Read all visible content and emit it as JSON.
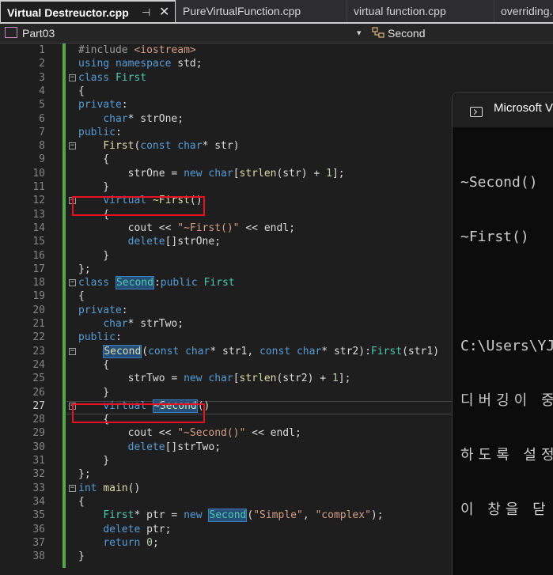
{
  "tabs": [
    {
      "label": "Virtual Destreuctor.cpp",
      "active": true
    },
    {
      "label": "PureVirtualFunction.cpp",
      "active": false
    },
    {
      "label": "virtual function.cpp",
      "active": false
    },
    {
      "label": "overriding.cpp",
      "active": false
    }
  ],
  "tab_pin": "⊣",
  "tab_close": "✕",
  "nav": {
    "project": "Part03",
    "scope": "Second",
    "dropdown": "▾"
  },
  "line_numbers": [
    "1",
    "2",
    "3",
    "4",
    "5",
    "6",
    "7",
    "8",
    "9",
    "10",
    "11",
    "12",
    "13",
    "14",
    "15",
    "16",
    "17",
    "18",
    "19",
    "20",
    "21",
    "22",
    "23",
    "24",
    "25",
    "26",
    "27",
    "28",
    "29",
    "30",
    "31",
    "32",
    "33",
    "34",
    "35",
    "36",
    "37",
    "38"
  ],
  "current_line": "27",
  "console": {
    "title": "Microsoft Visual Studio Debug Console",
    "lines": [
      "~Second()",
      "~First()",
      "",
      "C:\\Users\\YJ",
      "디버깅이 중지",
      "하도록 설정",
      "이 창을 닫"
    ]
  },
  "colors": {
    "keyword": "#569cd6",
    "type": "#4ec9b0",
    "function": "#dcdcaa",
    "string": "#d69d85",
    "change_bar": "#57a64a",
    "annotation": "#e81123"
  }
}
